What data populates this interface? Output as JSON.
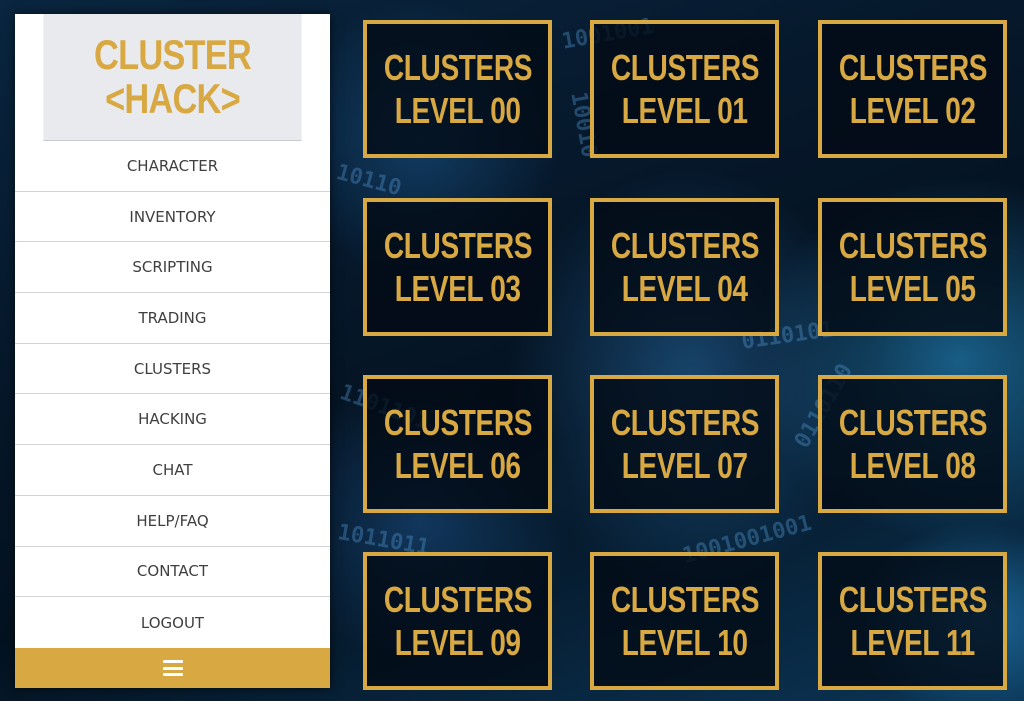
{
  "brand": {
    "line1": "CLUSTER",
    "line2": "<HACK>",
    "accent_color": "#d8a843"
  },
  "sidebar": {
    "items": [
      {
        "label": "CHARACTER"
      },
      {
        "label": "INVENTORY"
      },
      {
        "label": "SCRIPTING"
      },
      {
        "label": "TRADING"
      },
      {
        "label": "CLUSTERS"
      },
      {
        "label": "HACKING"
      },
      {
        "label": "CHAT"
      },
      {
        "label": "HELP/FAQ"
      },
      {
        "label": "CONTACT"
      },
      {
        "label": "LOGOUT"
      }
    ],
    "toggle_icon": "hamburger-menu-icon"
  },
  "levels": [
    {
      "title": "CLUSTERS",
      "level": "LEVEL 00"
    },
    {
      "title": "CLUSTERS",
      "level": "LEVEL 01"
    },
    {
      "title": "CLUSTERS",
      "level": "LEVEL 02"
    },
    {
      "title": "CLUSTERS",
      "level": "LEVEL 03"
    },
    {
      "title": "CLUSTERS",
      "level": "LEVEL 04"
    },
    {
      "title": "CLUSTERS",
      "level": "LEVEL 05"
    },
    {
      "title": "CLUSTERS",
      "level": "LEVEL 06"
    },
    {
      "title": "CLUSTERS",
      "level": "LEVEL 07"
    },
    {
      "title": "CLUSTERS",
      "level": "LEVEL 08"
    },
    {
      "title": "CLUSTERS",
      "level": "LEVEL 09"
    },
    {
      "title": "CLUSTERS",
      "level": "LEVEL 10"
    },
    {
      "title": "CLUSTERS",
      "level": "LEVEL 11"
    }
  ],
  "background": {
    "binary_lines": [
      "1001001",
      "0110101",
      "10110",
      "1001001001",
      "1011011",
      "0110110",
      "10010",
      "1101101"
    ]
  }
}
